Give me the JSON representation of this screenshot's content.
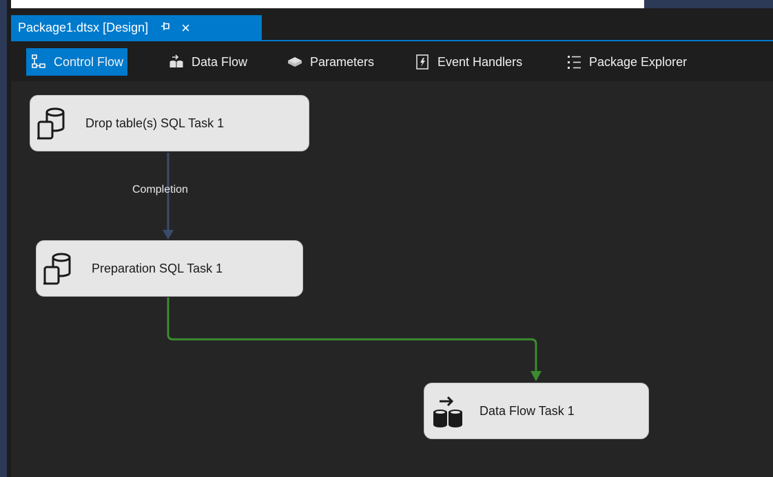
{
  "document_tab": {
    "title": "Package1.dtsx [Design]",
    "pin_icon": "pin-icon",
    "close_glyph": "×"
  },
  "designer_tabs": [
    {
      "label": "Control Flow",
      "icon": "control-flow-icon",
      "active": true
    },
    {
      "label": "Data Flow",
      "icon": "data-flow-icon",
      "active": false
    },
    {
      "label": "Parameters",
      "icon": "parameters-icon",
      "active": false
    },
    {
      "label": "Event Handlers",
      "icon": "event-handlers-icon",
      "active": false
    },
    {
      "label": "Package Explorer",
      "icon": "package-explorer-icon",
      "active": false
    }
  ],
  "tasks": [
    {
      "name": "Drop table(s) SQL Task 1",
      "icon": "sql-task-icon"
    },
    {
      "name": "Preparation SQL Task 1",
      "icon": "sql-task-icon"
    },
    {
      "name": "Data Flow Task 1",
      "icon": "data-flow-task-icon"
    }
  ],
  "connectors": [
    {
      "label": "Completion",
      "color": "#3b4c6b"
    },
    {
      "label": "",
      "color": "#3c8c2f"
    }
  ],
  "colors": {
    "accent": "#007acc",
    "canvas": "#252526",
    "success": "#3c8c2f",
    "completion": "#3b4c6b"
  }
}
